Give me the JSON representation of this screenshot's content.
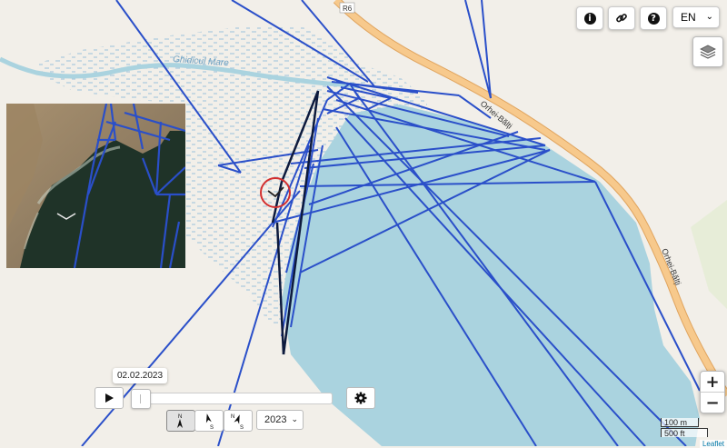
{
  "map": {
    "labels": {
      "road_code": "R6",
      "river_name": "Ghidicul Mare",
      "road_name_upper": "Orhei-Bălți",
      "road_name_lower": "Orhei-Bălți"
    },
    "attribution": "Leaflet"
  },
  "top_controls": {
    "info_icon": "info-icon",
    "link_icon": "link-icon",
    "help_icon": "help-icon",
    "language": "EN"
  },
  "scale": {
    "metric": "100 m",
    "imperial": "500 ft"
  },
  "timeline": {
    "date": "02.02.2023",
    "year": "2023",
    "slider_position": 0.0
  },
  "north_buttons": [
    {
      "letter_top": "N",
      "letter_bottom": ""
    },
    {
      "letter_top": "",
      "letter_bottom": "S"
    },
    {
      "letter_top": "N",
      "letter_bottom": "S"
    }
  ],
  "colors": {
    "track": "#2a4fc9",
    "water": "#aad3df",
    "wetland": "#a9c8dd",
    "road": "#f7c98c",
    "marker_circle": "#d32f2f"
  }
}
